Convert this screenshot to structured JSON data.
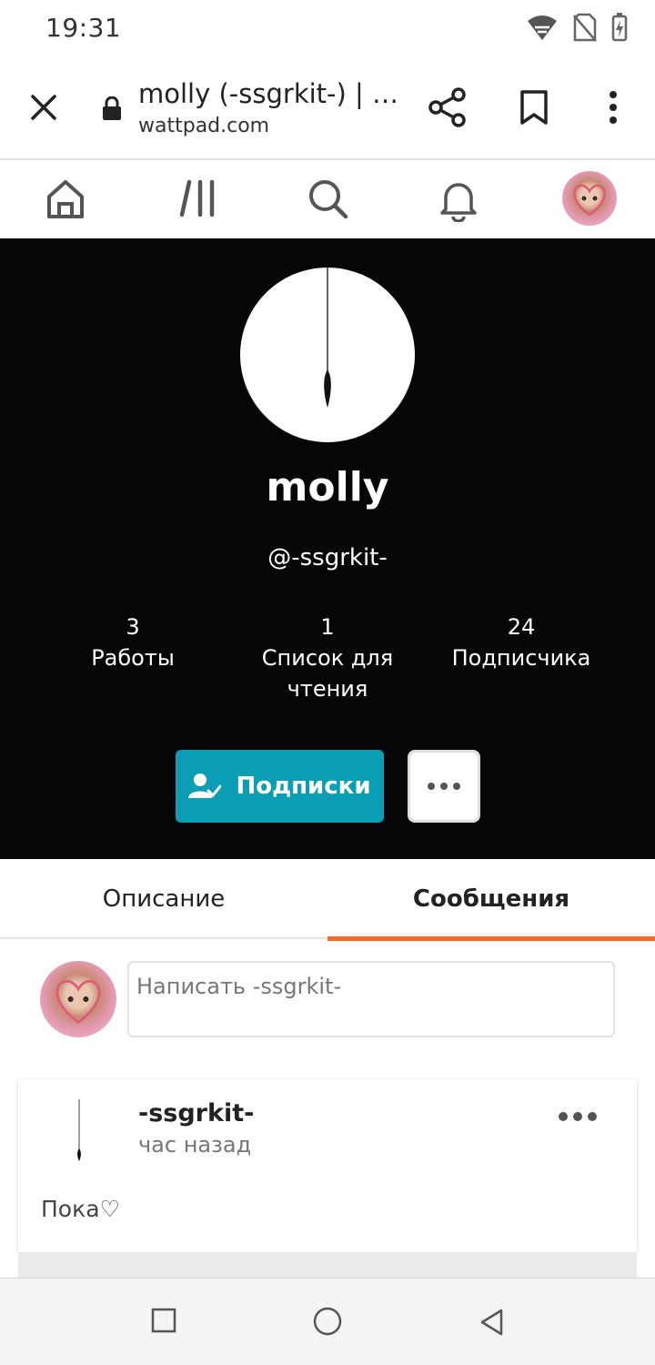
{
  "status_bar": {
    "time": "19:31"
  },
  "browser": {
    "title": "molly (-ssgrkit-) | …",
    "url": "wattpad.com"
  },
  "profile": {
    "name": "molly",
    "handle": "@-ssgrkit-",
    "stats": [
      {
        "value": "3",
        "label": "Работы"
      },
      {
        "value": "1",
        "label": "Список для чтения"
      },
      {
        "value": "24",
        "label": "Подписчика"
      }
    ],
    "follow_label": "Подписки"
  },
  "tabs": [
    {
      "label": "Описание",
      "active": false
    },
    {
      "label": "Сообщения",
      "active": true
    }
  ],
  "composer": {
    "placeholder": "Написать -ssgrkit-"
  },
  "messages": [
    {
      "author": "-ssgrkit-",
      "time": "час назад",
      "text": "Пока♡"
    }
  ],
  "colors": {
    "accent": "#0a9db4",
    "tab_underline": "#f46a25",
    "header_bg": "#060606"
  }
}
